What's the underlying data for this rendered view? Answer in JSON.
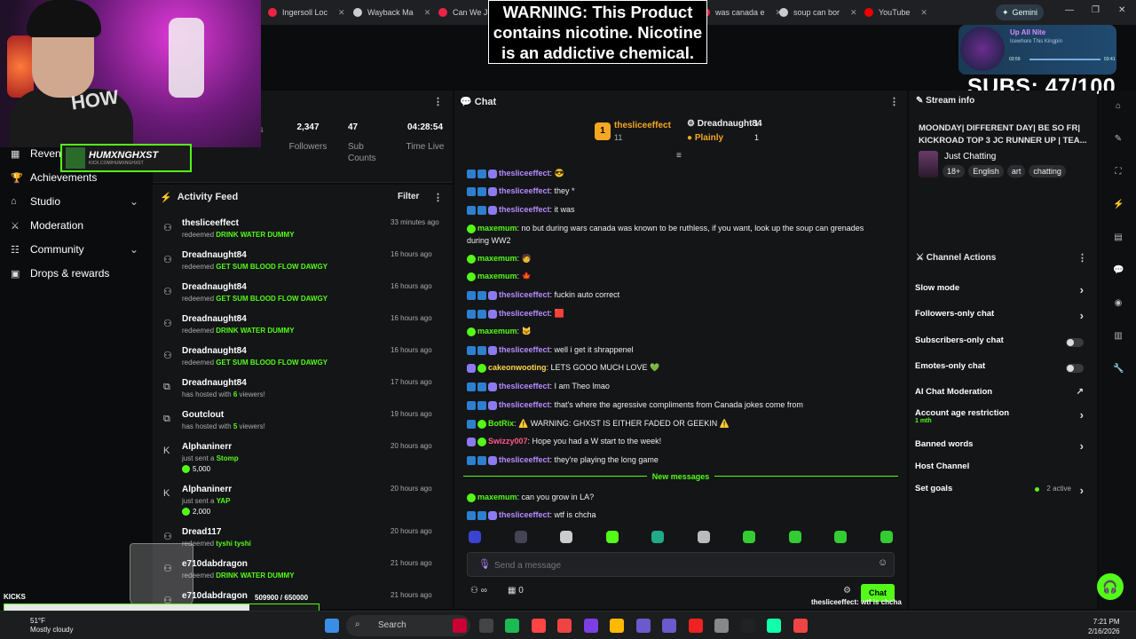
{
  "browser": {
    "tabs": [
      "Ingersoll Loc",
      "Wayback Ma",
      "Can We Jus",
      "was canada e",
      "soup can bor",
      "YouTube"
    ],
    "gemini": "Gemini"
  },
  "overlay": {
    "warning": "WARNING: This Product contains nicotine. Nicotine is an addictive chemical.",
    "subs": "SUBS: 47/100",
    "hoodie": "HOW",
    "logo_name": "HUMXNGHXST",
    "logo_sub": "KICK.COM/HUMXNGHXST",
    "kicks_label": "KICKS",
    "kicks_progress": "509900 / 650000",
    "kicks_fraction": 0.78,
    "music": {
      "song": "Up All Nite",
      "artist": "Icewhore This Kingpin",
      "time_now": "03:59",
      "time_total": "03:41"
    }
  },
  "sidebar": {
    "items": [
      {
        "label": "Revenue",
        "icon": "revenue-icon",
        "chevron": false
      },
      {
        "label": "Achievements",
        "icon": "trophy-icon",
        "chevron": false
      },
      {
        "label": "Studio",
        "icon": "studio-icon",
        "chevron": true
      },
      {
        "label": "Moderation",
        "icon": "sword-icon",
        "chevron": false
      },
      {
        "label": "Community",
        "icon": "community-icon",
        "chevron": true
      },
      {
        "label": "Drops & rewards",
        "icon": "gift-icon",
        "chevron": false
      }
    ]
  },
  "stats": [
    {
      "value": "",
      "label": "Viewers"
    },
    {
      "value": "2,347",
      "label": "Followers"
    },
    {
      "value": "47",
      "label": "Sub Counts"
    },
    {
      "value": "04:28:54",
      "label": "Time Live"
    }
  ],
  "activity": {
    "title": "Activity Feed",
    "filter": "Filter",
    "rows": [
      {
        "user": "thesliceeffect",
        "verb": "redeemed",
        "item": "DRINK WATER DUMMY",
        "time": "33 minutes ago",
        "amount": ""
      },
      {
        "user": "Dreadnaught84",
        "verb": "redeemed",
        "item": "GET SUM BLOOD FLOW DAWGY",
        "time": "16 hours ago",
        "amount": ""
      },
      {
        "user": "Dreadnaught84",
        "verb": "redeemed",
        "item": "GET SUM BLOOD FLOW DAWGY",
        "time": "16 hours ago",
        "amount": ""
      },
      {
        "user": "Dreadnaught84",
        "verb": "redeemed",
        "item": "DRINK WATER DUMMY",
        "time": "16 hours ago",
        "amount": ""
      },
      {
        "user": "Dreadnaught84",
        "verb": "redeemed",
        "item": "GET SUM BLOOD FLOW DAWGY",
        "time": "16 hours ago",
        "amount": ""
      },
      {
        "user": "Dreadnaught84",
        "verb": "has hosted with",
        "item": "6",
        "suffix": "viewers!",
        "time": "17 hours ago",
        "amount": ""
      },
      {
        "user": "Goutclout",
        "verb": "has hosted with",
        "item": "5",
        "suffix": "viewers!",
        "time": "19 hours ago",
        "amount": ""
      },
      {
        "user": "Alphaninerr",
        "verb": "just sent a",
        "item": "Stomp",
        "time": "20 hours ago",
        "amount": "5,000"
      },
      {
        "user": "Alphaninerr",
        "verb": "just sent a",
        "item": "YAP",
        "time": "20 hours ago",
        "amount": "2,000"
      },
      {
        "user": "Dread117",
        "verb": "redeemed",
        "item": "tyshi tyshi",
        "time": "20 hours ago",
        "amount": ""
      },
      {
        "user": "e710dabdragon",
        "verb": "redeemed",
        "item": "DRINK WATER DUMMY",
        "time": "21 hours ago",
        "amount": ""
      },
      {
        "user": "e710dabdragon",
        "verb": "",
        "item": "",
        "time": "21 hours ago",
        "amount": ""
      }
    ]
  },
  "chat": {
    "title": "Chat",
    "top_gifters": [
      {
        "name": "thesliceeffect",
        "count": "11",
        "rank": "1"
      },
      {
        "name": "Dreadnaught84",
        "count": "1"
      },
      {
        "name": "Plainly",
        "count": "1"
      }
    ],
    "messages": [
      {
        "user": "thesliceeffect",
        "text": "😎",
        "color": "#b58cff",
        "badges": [
          "bl",
          "bl",
          "pu"
        ]
      },
      {
        "user": "thesliceeffect",
        "text": "they *",
        "color": "#b58cff",
        "badges": [
          "bl",
          "bl",
          "pu"
        ]
      },
      {
        "user": "thesliceeffect",
        "text": "it was",
        "color": "#b58cff",
        "badges": [
          "bl",
          "bl",
          "pu"
        ]
      },
      {
        "user": "maxemum",
        "text": "no but during wars canada was known to be ruthless, if you want, look up the soup can grenades",
        "color": "#53fc18",
        "badges": [
          "gn"
        ]
      },
      {
        "user": "",
        "text": "during WW2",
        "color": "#fff",
        "badges": []
      },
      {
        "user": "maxemum",
        "text": "🧑",
        "color": "#53fc18",
        "badges": [
          "gn"
        ]
      },
      {
        "user": "maxemum",
        "text": "🍁",
        "color": "#53fc18",
        "badges": [
          "gn"
        ]
      },
      {
        "user": "thesliceeffect",
        "text": "fuckin auto correct",
        "color": "#b58cff",
        "badges": [
          "bl",
          "bl",
          "pu"
        ]
      },
      {
        "user": "thesliceeffect",
        "text": "🟥",
        "color": "#b58cff",
        "badges": [
          "bl",
          "bl",
          "pu"
        ]
      },
      {
        "user": "maxemum",
        "text": "🐱",
        "color": "#53fc18",
        "badges": [
          "gn"
        ]
      },
      {
        "user": "thesliceeffect",
        "text": "well i get it shrappenel",
        "color": "#b58cff",
        "badges": [
          "bl",
          "bl",
          "pu"
        ]
      },
      {
        "user": "cakeonwooting",
        "text": "LETS GOOO MUCH LOVE 💚",
        "color": "#ffd54a",
        "badges": [
          "pu",
          "gn"
        ]
      },
      {
        "user": "thesliceeffect",
        "text": "I am Theo lmao",
        "color": "#b58cff",
        "badges": [
          "bl",
          "bl",
          "pu"
        ]
      },
      {
        "user": "thesliceeffect",
        "text": "that's where the agressive compliments from Canada jokes come from",
        "color": "#b58cff",
        "badges": [
          "bl",
          "bl",
          "pu"
        ]
      },
      {
        "user": "BotRix",
        "text": "⚠️ WARNING: GHXST IS EITHER FADED OR GEEKIN ⚠️",
        "color": "#53fc18",
        "badges": [
          "bl",
          "gn"
        ]
      },
      {
        "user": "Swizzy007",
        "text": "Hope you had a W start to the week!",
        "color": "#ff5a8a",
        "badges": [
          "pu",
          "gn"
        ]
      },
      {
        "user": "thesliceeffect",
        "text": "they're playing the long game",
        "color": "#b58cff",
        "badges": [
          "bl",
          "bl",
          "pu"
        ]
      }
    ],
    "new_messages": "New messages",
    "new": [
      {
        "user": "maxemum",
        "text": "can you grow in LA?",
        "color": "#53fc18",
        "badges": [
          "gn"
        ]
      },
      {
        "user": "thesliceeffect",
        "text": "wtf is chcha",
        "color": "#b58cff",
        "badges": [
          "bl",
          "bl",
          "pu"
        ]
      }
    ],
    "placeholder": "Send a message",
    "points": "0",
    "send": "Chat",
    "overlay_line": "thesliceeffect: wtf is chcha"
  },
  "stream_info": {
    "title": "Stream info",
    "stream_title": "MOONDAY| DIFFERENT DAY| BE SO FR| KICKROAD TOP 3 JC RUNNER UP | TEA...",
    "category": "Just Chatting",
    "tags": [
      "18+",
      "English",
      "art",
      "chatting"
    ]
  },
  "channel_actions": {
    "title": "Channel Actions",
    "rows": [
      {
        "label": "Slow mode",
        "type": "chevron"
      },
      {
        "label": "Followers-only chat",
        "type": "chevron"
      },
      {
        "label": "Subscribers-only chat",
        "type": "toggle"
      },
      {
        "label": "Emotes-only chat",
        "type": "toggle"
      },
      {
        "label": "AI Chat Moderation",
        "type": "link"
      },
      {
        "label": "Account age restriction",
        "sub": "1 mth",
        "type": "chevron"
      },
      {
        "label": "Banned words",
        "type": "chevron"
      },
      {
        "label": "Host Channel",
        "type": "none"
      },
      {
        "label": "Set goals",
        "status": "2 active",
        "type": "chevron"
      }
    ]
  },
  "taskbar": {
    "weather_temp": "51°F",
    "weather_desc": "Mostly cloudy",
    "search": "Search",
    "time": "7:21 PM",
    "date": "2/16/2026"
  }
}
